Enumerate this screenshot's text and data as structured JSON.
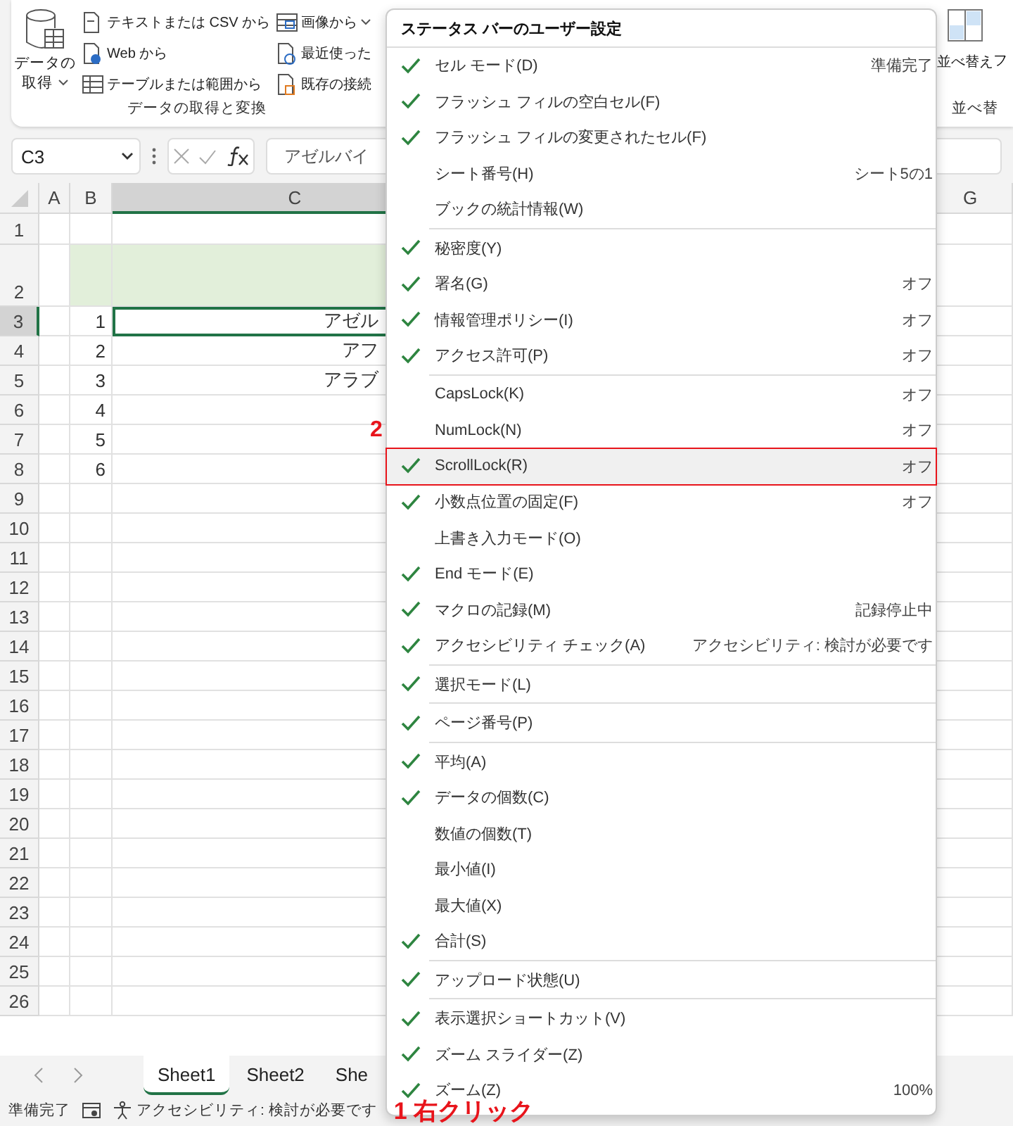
{
  "ribbon": {
    "get_data": {
      "line1": "データの",
      "line2": "取得"
    },
    "column_1": [
      {
        "label": "テキストまたは CSV から",
        "kind": "text"
      },
      {
        "label": "Web から",
        "kind": "web"
      },
      {
        "label": "テーブルまたは範囲から",
        "kind": "table"
      }
    ],
    "column_2": [
      {
        "label": "画像から",
        "kind": "image",
        "dropdown": true
      },
      {
        "label": "最近使った",
        "kind": "recent",
        "dropdown": false
      },
      {
        "label": "既存の接続",
        "kind": "existing",
        "dropdown": false
      }
    ],
    "group_label": "データの取得と変換",
    "sort": {
      "label": "並べ替え",
      "next": "フ",
      "group_label": "並べ替"
    }
  },
  "formula_bar": {
    "name_box": "C3",
    "value": "アゼルバイ"
  },
  "grid": {
    "columns": [
      {
        "label": "A",
        "selected": false
      },
      {
        "label": "B",
        "selected": false
      },
      {
        "label": "C",
        "selected": true
      },
      {
        "label": "G",
        "selected": false
      }
    ],
    "rows": [
      {
        "label": "1",
        "tall": false,
        "filled": false,
        "selected": false
      },
      {
        "label": "2",
        "tall": true,
        "filled": true,
        "selected": false
      },
      {
        "label": "3",
        "b": "1",
        "c": "アゼル",
        "tall": false,
        "filled": false,
        "selected": true
      },
      {
        "label": "4",
        "b": "2",
        "c": "アフ",
        "tall": false,
        "filled": false,
        "selected": false
      },
      {
        "label": "5",
        "b": "3",
        "c": "アラブ",
        "tall": false,
        "filled": false,
        "selected": false
      },
      {
        "label": "6",
        "b": "4",
        "tall": false,
        "filled": false,
        "selected": false
      },
      {
        "label": "7",
        "b": "5",
        "tall": false,
        "filled": false,
        "selected": false
      },
      {
        "label": "8",
        "b": "6",
        "tall": false,
        "filled": false,
        "selected": false
      },
      {
        "label": "9"
      },
      {
        "label": "10"
      },
      {
        "label": "11"
      },
      {
        "label": "12"
      },
      {
        "label": "13"
      },
      {
        "label": "14"
      },
      {
        "label": "15"
      },
      {
        "label": "16"
      },
      {
        "label": "17"
      },
      {
        "label": "18"
      },
      {
        "label": "19"
      },
      {
        "label": "20"
      },
      {
        "label": "21"
      },
      {
        "label": "22"
      },
      {
        "label": "23"
      },
      {
        "label": "24"
      },
      {
        "label": "25"
      },
      {
        "label": "26"
      }
    ]
  },
  "sheet_tabs": [
    {
      "label": "Sheet1",
      "selected": true
    },
    {
      "label": "Sheet2",
      "selected": false
    },
    {
      "label": "She",
      "selected": false
    }
  ],
  "status_bar": {
    "ready": "準備完了",
    "accessibility": "アクセシビリティ: 検討が必要です",
    "callout": "1 右クリック"
  },
  "menu": {
    "title": "ステータス バーのユーザー設定",
    "groups": [
      {
        "items": [
          {
            "label": "セル モード(D)",
            "value": "準備完了",
            "checked": true
          },
          {
            "label": "フラッシュ フィルの空白セル(F)",
            "checked": true
          },
          {
            "label": "フラッシュ フィルの変更されたセル(F)",
            "checked": true
          },
          {
            "label": "シート番号(H)",
            "value": "シート5の1",
            "checked": false
          },
          {
            "label": "ブックの統計情報(W)",
            "checked": false
          }
        ]
      },
      {
        "items": [
          {
            "label": "秘密度(Y)",
            "checked": true
          },
          {
            "label": "署名(G)",
            "value": "オフ",
            "checked": true
          },
          {
            "label": "情報管理ポリシー(I)",
            "value": "オフ",
            "checked": true
          },
          {
            "label": "アクセス許可(P)",
            "value": "オフ",
            "checked": true
          }
        ]
      },
      {
        "items": [
          {
            "label": "CapsLock(K)",
            "value": "オフ",
            "checked": false
          },
          {
            "label": "NumLock(N)",
            "value": "オフ",
            "checked": false
          },
          {
            "label": "ScrollLock(R)",
            "value": "オフ",
            "checked": true,
            "highlighted": true,
            "callout": "2"
          },
          {
            "label": "小数点位置の固定(F)",
            "value": "オフ",
            "checked": true
          },
          {
            "label": "上書き入力モード(O)",
            "checked": false
          },
          {
            "label": "End モード(E)",
            "checked": true
          },
          {
            "label": "マクロの記録(M)",
            "value": "記録停止中",
            "checked": true
          },
          {
            "label": "アクセシビリティ チェック(A)",
            "value": "アクセシビリティ: 検討が必要です",
            "checked": true
          }
        ]
      },
      {
        "items": [
          {
            "label": "選択モード(L)",
            "checked": true
          }
        ]
      },
      {
        "items": [
          {
            "label": "ページ番号(P)",
            "checked": true
          }
        ]
      },
      {
        "items": [
          {
            "label": "平均(A)",
            "checked": true
          },
          {
            "label": "データの個数(C)",
            "checked": true
          },
          {
            "label": "数値の個数(T)",
            "checked": false
          },
          {
            "label": "最小値(I)",
            "checked": false
          },
          {
            "label": "最大値(X)",
            "checked": false
          },
          {
            "label": "合計(S)",
            "checked": true
          }
        ]
      },
      {
        "items": [
          {
            "label": "アップロード状態(U)",
            "checked": true
          }
        ]
      },
      {
        "items": [
          {
            "label": "表示選択ショートカット(V)",
            "checked": true
          },
          {
            "label": "ズーム スライダー(Z)",
            "checked": true
          },
          {
            "label": "ズーム(Z)",
            "value": "100%",
            "checked": true
          }
        ]
      }
    ]
  }
}
